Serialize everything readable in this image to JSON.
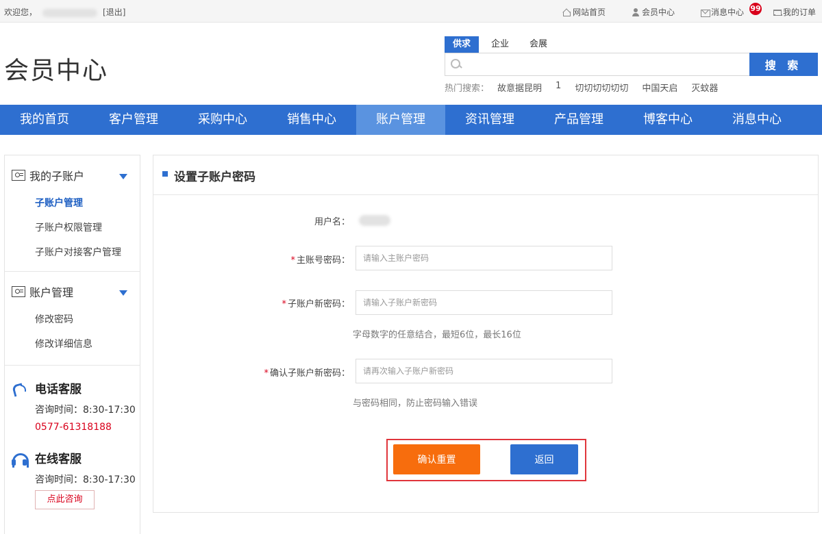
{
  "topbar": {
    "welcome": "欢迎您，",
    "logout": "[退出]",
    "links": {
      "home": "网站首页",
      "member": "会员中心",
      "messages": "消息中心",
      "orders": "我的订单"
    },
    "message_badge": "99"
  },
  "header": {
    "title": "会员中心",
    "search_tabs": [
      "供求",
      "企业",
      "会展"
    ],
    "search_placeholder": "",
    "search_button": "搜 索",
    "hot_label": "热门搜索：",
    "hot_terms": [
      "故意据昆明",
      "1",
      "切切切切切切",
      "中国天启",
      "灭蚊器"
    ]
  },
  "nav": {
    "items": [
      "我的首页",
      "客户管理",
      "采购中心",
      "销售中心",
      "账户管理",
      "资讯管理",
      "产品管理",
      "博客中心",
      "消息中心"
    ],
    "active_index": 4
  },
  "sidebar": {
    "group1": {
      "title": "我的子账户",
      "links": [
        "子账户管理",
        "子账户权限管理",
        "子账户对接客户管理"
      ]
    },
    "group2": {
      "title": "账户管理",
      "links": [
        "修改密码",
        "修改详细信息"
      ]
    },
    "phone_service": {
      "title": "电话客服",
      "hours": "咨询时间：8:30-17:30",
      "phone": "0577-61318188"
    },
    "online_service": {
      "title": "在线客服",
      "hours": "咨询时间：8:30-17:30",
      "button": "点此咨询"
    }
  },
  "form": {
    "title": "设置子账户密码",
    "username_label": "用户名：",
    "master_label": "主账号密码：",
    "master_placeholder": "请输入主账户密码",
    "new_label": "子账户新密码：",
    "new_placeholder": "请输入子账户新密码",
    "new_hint": "字母数字的任意结合，最短6位，最长16位",
    "confirm_label": "确认子账户新密码：",
    "confirm_placeholder": "请再次输入子账户新密码",
    "confirm_hint": "与密码相同，防止密码输入错误",
    "required_mark": "*",
    "submit_button": "确认重置",
    "back_button": "返回"
  },
  "colors": {
    "primary": "#2e6fd0",
    "nav_active": "#5a93e0",
    "accent_orange": "#f76d0d",
    "alert_red": "#d9001b"
  }
}
